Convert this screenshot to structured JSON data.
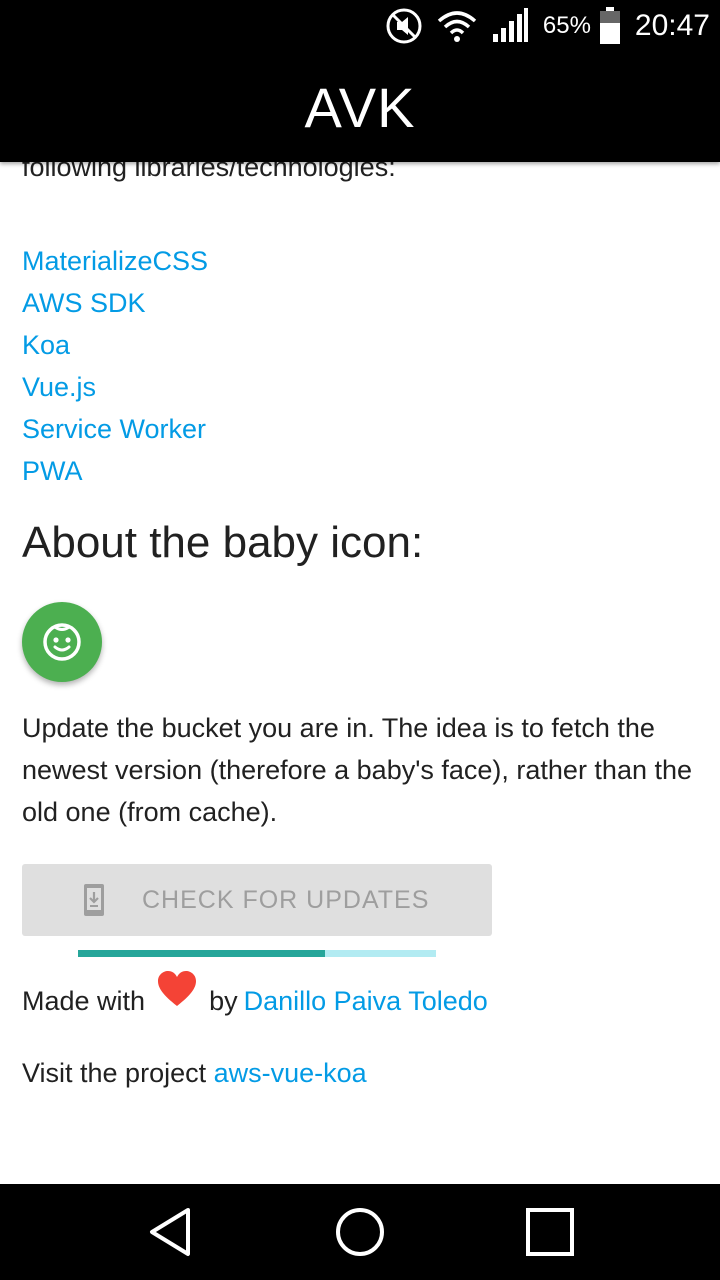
{
  "status_bar": {
    "battery_percent": "65%",
    "time": "20:47",
    "icons": [
      "mute-icon",
      "wifi-icon",
      "signal-icon",
      "battery-icon"
    ]
  },
  "app_bar": {
    "title": "AVK"
  },
  "content": {
    "intro_tail": "following libraries/technologies:",
    "libraries": [
      "MaterializeCSS",
      "AWS SDK",
      "Koa",
      "Vue.js",
      "Service Worker",
      "PWA"
    ],
    "section_title": "About the baby icon:",
    "description": "Update the bucket you are in. The idea is to fetch the newest version (therefore a baby's face), rather than the old one (from cache).",
    "update_button_label": "CHECK FOR UPDATES",
    "progress": 0.69,
    "made_with_prefix": "Made with",
    "made_with_by": "by",
    "author": "Danillo Paiva Toledo",
    "visit_prefix": "Visit the project",
    "project": "aws-vue-koa"
  },
  "colors": {
    "link": "#039be5",
    "fab": "#4caf50",
    "heart": "#f44336",
    "progress_fill": "#26a69a",
    "progress_track": "#b2ebf2"
  }
}
